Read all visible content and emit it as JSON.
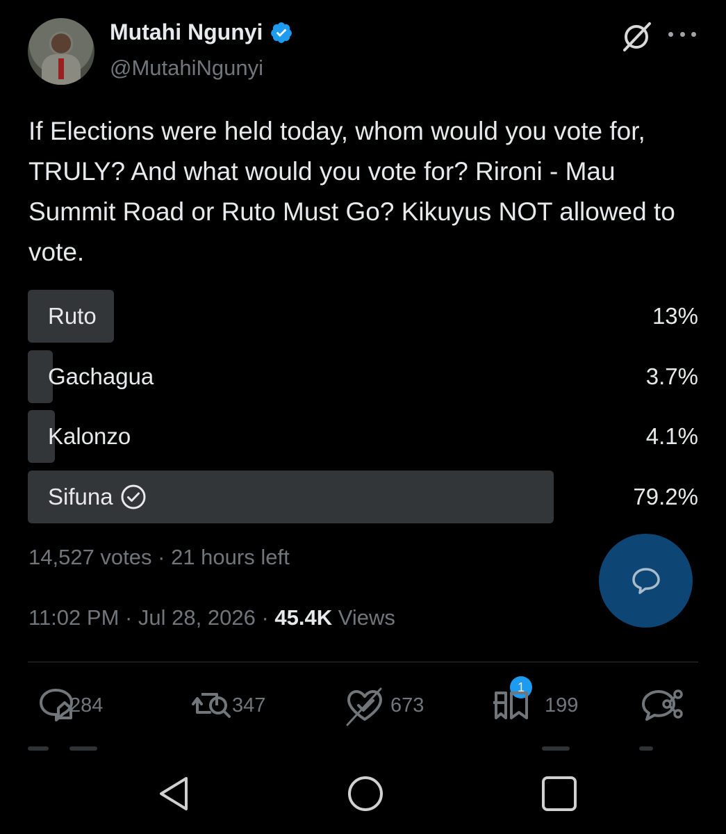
{
  "author": {
    "name": "Mutahi Ngunyi",
    "handle": "@MutahiNgunyi",
    "verified": true
  },
  "tweet": {
    "text": "If Elections were held today, whom would you vote for, TRULY? And what would you vote for? Rironi - Mau Summit Road or Ruto Must Go? Kikuyus NOT allowed to vote."
  },
  "poll": {
    "options": [
      {
        "label": "Ruto",
        "percent_label": "13%",
        "share": 0.13,
        "selected": false
      },
      {
        "label": "Gachagua",
        "percent_label": "3.7%",
        "share": 0.037,
        "selected": false
      },
      {
        "label": "Kalonzo",
        "percent_label": "4.1%",
        "share": 0.041,
        "selected": false
      },
      {
        "label": "Sifuna",
        "percent_label": "79.2%",
        "share": 0.792,
        "selected": true
      }
    ],
    "meta": "14,527 votes · 21 hours left"
  },
  "timestamp": {
    "time": "11:02 PM · Jul 28, 2026 · ",
    "views_count": "45.4K",
    "views_label": " Views"
  },
  "actions": {
    "replies": "284",
    "reposts": "347",
    "likes": "673",
    "bookmarks": "199",
    "bookmark_badge": "1"
  },
  "icons": {
    "verified": "verified-badge-icon",
    "grok": "grok-icon",
    "more": "more-dots-icon",
    "reply": "reply-icon",
    "repost": "repost-icon",
    "like": "like-icon",
    "bookmark": "bookmark-icon",
    "share": "share-icon",
    "compose": "compose-reply-icon"
  },
  "colors": {
    "background": "#000000",
    "text": "#e7e9ea",
    "muted": "#71767b",
    "poll_bar": "#333639",
    "accent": "#1d9bf0",
    "fab": "#0d4574"
  }
}
